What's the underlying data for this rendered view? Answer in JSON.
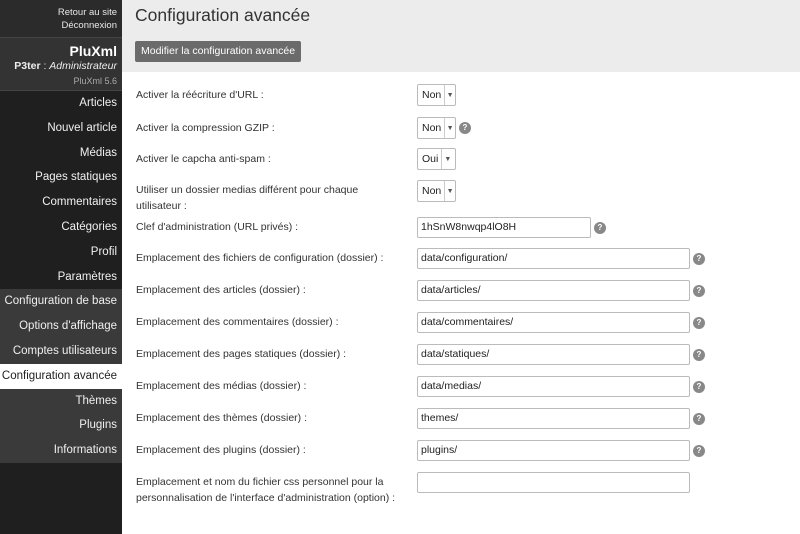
{
  "sidebar": {
    "top_links": [
      "Retour au site",
      "Déconnexion"
    ],
    "site_name": "PluXml",
    "user_name": "P3ter",
    "user_sep": " : ",
    "user_role": "Administrateur",
    "version": "PluXml 5.6",
    "menu": [
      "Articles",
      "Nouvel article",
      "Médias",
      "Pages statiques",
      "Commentaires",
      "Catégories",
      "Profil",
      "Paramètres"
    ],
    "submenu": [
      "Configuration de base",
      "Options d'affichage",
      "Comptes utilisateurs",
      "Configuration avancée",
      "Thèmes",
      "Plugins",
      "Informations"
    ],
    "active_item": "Configuration avancée"
  },
  "header": {
    "title": "Configuration avancée",
    "button_label": "Modifier la configuration avancée"
  },
  "form": {
    "url_rewrite": {
      "label": "Activer la réécriture d'URL :",
      "value": "Non"
    },
    "gzip": {
      "label": "Activer la compression GZIP :",
      "value": "Non"
    },
    "capcha": {
      "label": "Activer le capcha anti-spam :",
      "value": "Oui"
    },
    "medias_per_user": {
      "label": "Utiliser un dossier medias différent pour chaque utilisateur :",
      "value": "Non"
    },
    "admin_key": {
      "label": "Clef d'administration (URL privés) :",
      "value": "1hSnW8nwqp4lO8H"
    },
    "config_dir": {
      "label": "Emplacement des fichiers de configuration (dossier) :",
      "value": "data/configuration/"
    },
    "articles_dir": {
      "label": "Emplacement des articles (dossier) :",
      "value": "data/articles/"
    },
    "comments_dir": {
      "label": "Emplacement des commentaires (dossier) :",
      "value": "data/commentaires/"
    },
    "statics_dir": {
      "label": "Emplacement des pages statiques (dossier) :",
      "value": "data/statiques/"
    },
    "medias_dir": {
      "label": "Emplacement des médias (dossier) :",
      "value": "data/medias/"
    },
    "themes_dir": {
      "label": "Emplacement des thèmes (dossier) :",
      "value": "themes/"
    },
    "plugins_dir": {
      "label": "Emplacement des plugins (dossier) :",
      "value": "plugins/"
    },
    "custom_css": {
      "label": "Emplacement et nom du fichier css personnel pour la personnalisation de l'interface d'administration (option) :",
      "value": ""
    }
  },
  "help_glyph": "?",
  "arrow_glyph": "▼"
}
